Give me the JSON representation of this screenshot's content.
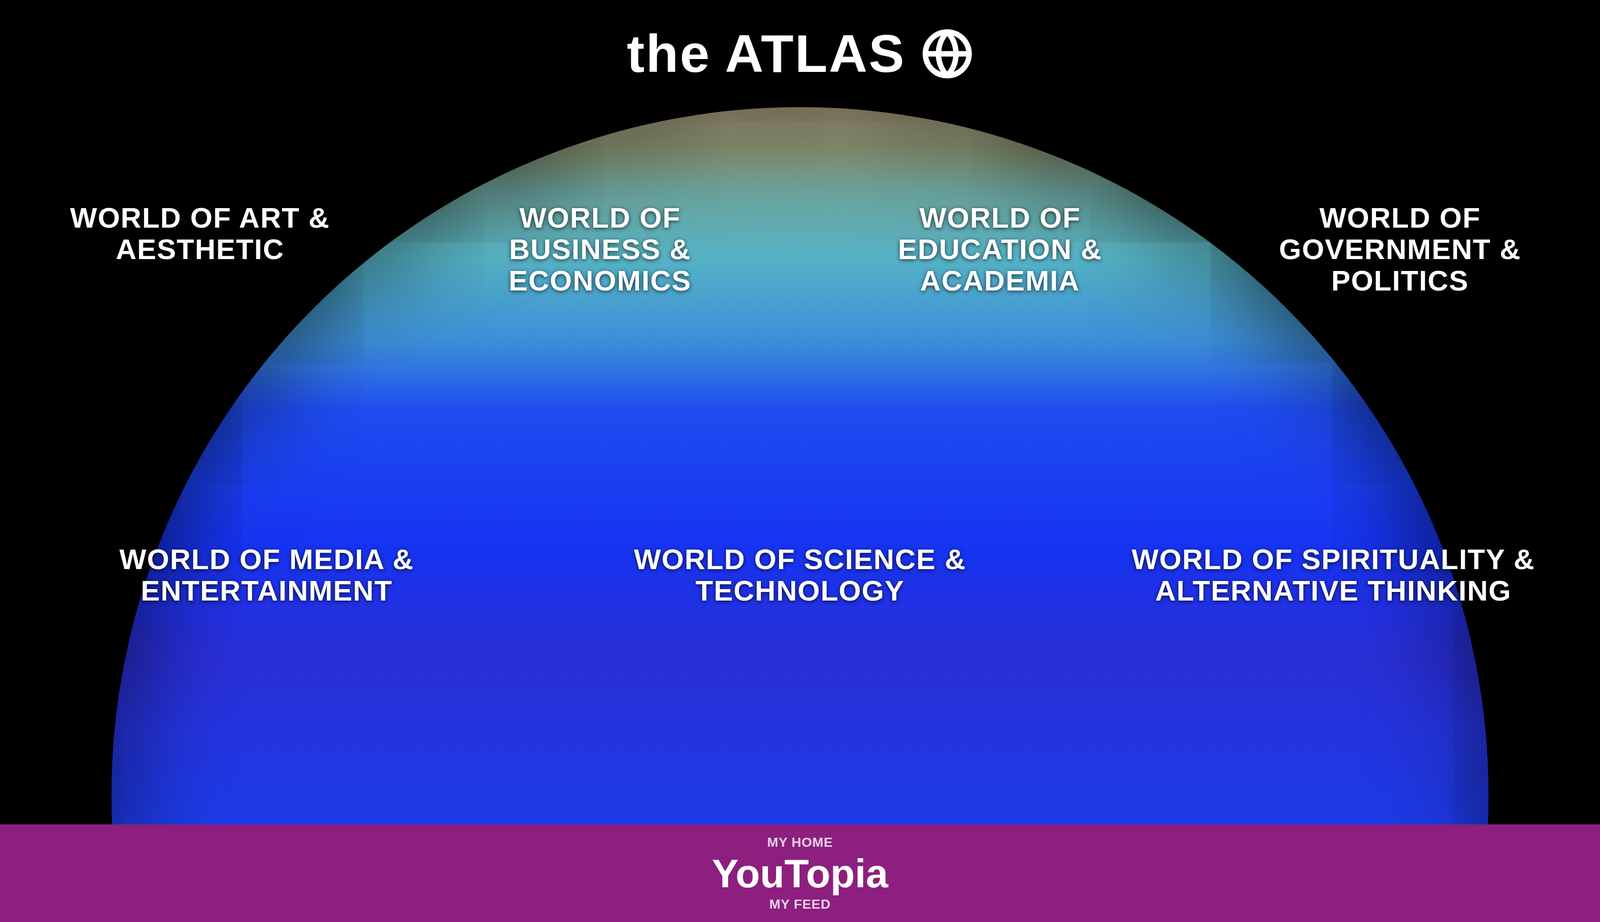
{
  "header": {
    "title": "the ATLAS"
  },
  "worlds": [
    [
      {
        "lines": [
          "WORLD OF ART &",
          "AESTHETIC"
        ]
      },
      {
        "lines": [
          "WORLD OF",
          "BUSINESS &",
          "ECONOMICS"
        ]
      },
      {
        "lines": [
          "WORLD OF",
          "EDUCATION &",
          "ACADEMIA"
        ]
      },
      {
        "lines": [
          "WORLD OF",
          "GOVERNMENT &",
          "POLITICS"
        ]
      }
    ],
    [
      {
        "lines": [
          "WORLD OF MEDIA &",
          "ENTERTAINMENT"
        ]
      },
      {
        "lines": [
          "WORLD OF SCIENCE &",
          "TECHNOLOGY"
        ]
      },
      {
        "lines": [
          "WORLD OF SPIRITUALITY &",
          "ALTERNATIVE THINKING"
        ]
      }
    ]
  ],
  "footer": {
    "top": "MY HOME",
    "title": "YouTopia",
    "bottom": "MY FEED"
  }
}
